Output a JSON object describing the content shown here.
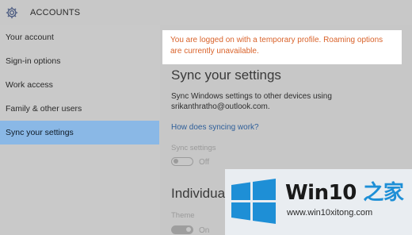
{
  "app": {
    "title": "ACCOUNTS",
    "icon": "gear-icon"
  },
  "sidebar": {
    "items": [
      {
        "label": "Your account"
      },
      {
        "label": "Sign-in options"
      },
      {
        "label": "Work access"
      },
      {
        "label": "Family & other users"
      },
      {
        "label": "Sync your settings",
        "active": true
      }
    ]
  },
  "notice": {
    "text": "You are logged on with a temporary profile. Roaming options are currently unavailable.",
    "color": "#d9622a"
  },
  "main": {
    "heading": "Sync your settings",
    "description": "Sync Windows settings to other devices using srikanthratho@outlook.com.",
    "link": "How does syncing work?",
    "sync_settings": {
      "label": "Sync settings",
      "state": "Off"
    },
    "individual_heading": "Individual s",
    "theme": {
      "label": "Theme",
      "state": "On"
    }
  },
  "watermark": {
    "title_part1": "Win10 ",
    "title_part2": "之家",
    "url": "www.win10xitong.com",
    "accent": "#1e8fd6"
  },
  "colors": {
    "active_nav": "#8ab8e6",
    "link": "#2f5f9a"
  }
}
